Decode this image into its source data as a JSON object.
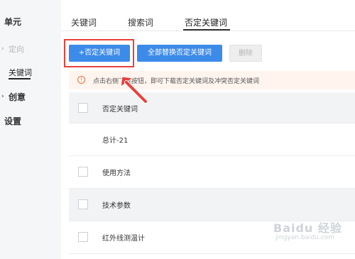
{
  "sidebar": {
    "items": [
      {
        "label": "单元"
      },
      {
        "label": "定向"
      },
      {
        "label": "关键词"
      },
      {
        "label": "创意"
      },
      {
        "label": "设置"
      }
    ]
  },
  "tabs": [
    {
      "label": "关键词"
    },
    {
      "label": "搜索词"
    },
    {
      "label": "否定关键词",
      "active": true
    }
  ],
  "toolbar": {
    "add_label": "+否定关键词",
    "replace_label": "全部替换否定关键词",
    "delete_label": "删除"
  },
  "notice": {
    "icon": "!",
    "text": "点击右侧下载按钮，即可下载否定关键词及冲突否定关键词"
  },
  "table": {
    "header": "否定关键词",
    "summary": "总计-21",
    "rows": [
      {
        "keyword": "使用方法"
      },
      {
        "keyword": "技术参数"
      },
      {
        "keyword": "红外线测温计"
      }
    ]
  },
  "watermark": {
    "main": "Baidu 经验",
    "sub": "jingyan.baidu.com"
  },
  "colors": {
    "primary": "#3d8be8",
    "highlight": "#e8423b",
    "notice_bg": "#fff4ee",
    "notice_accent": "#e8763b"
  }
}
